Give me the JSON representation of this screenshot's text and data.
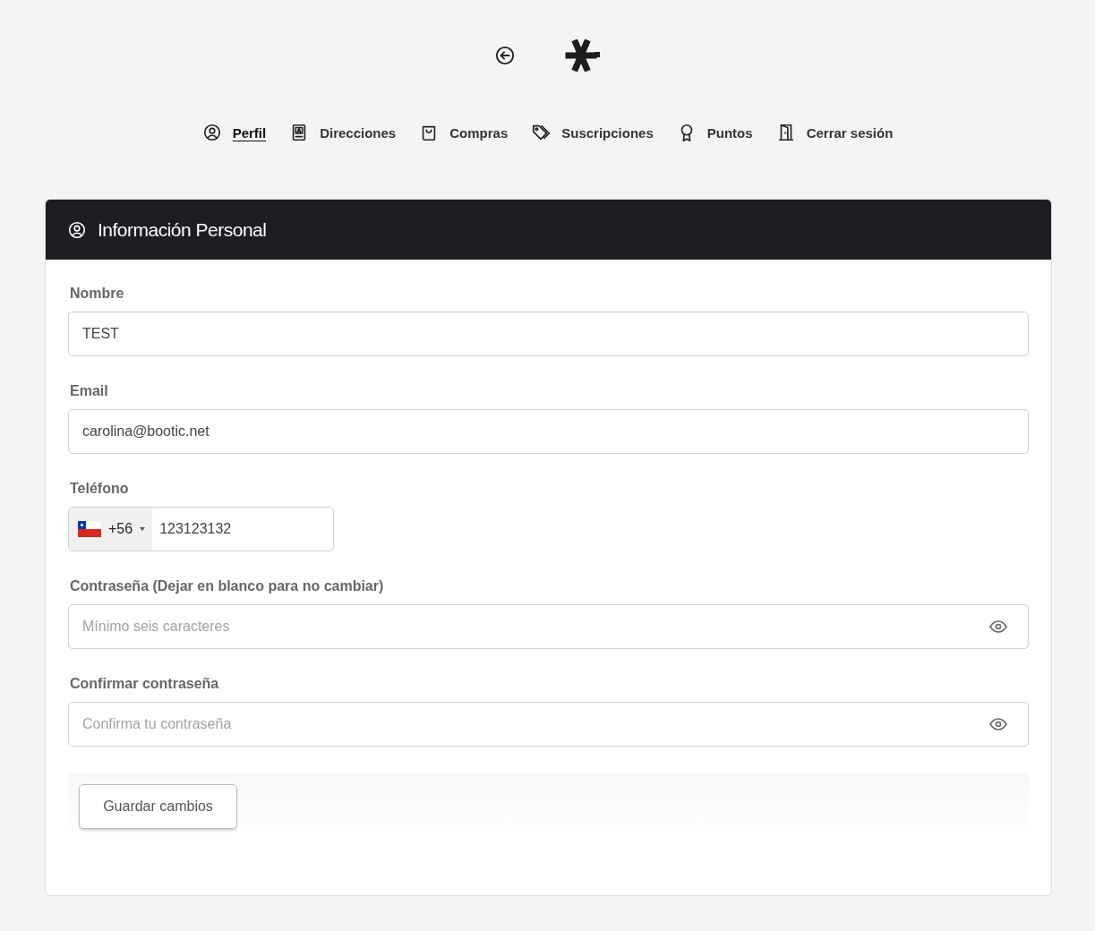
{
  "nav": [
    {
      "label": "Perfil",
      "selected": true
    },
    {
      "label": "Direcciones",
      "selected": false
    },
    {
      "label": "Compras",
      "selected": false
    },
    {
      "label": "Suscripciones",
      "selected": false
    },
    {
      "label": "Puntos",
      "selected": false
    },
    {
      "label": "Cerrar sesión",
      "selected": false
    }
  ],
  "card": {
    "title": "Información Personal",
    "fields": [
      {
        "kind": "text",
        "label": "Nombre",
        "value": "TEST"
      },
      {
        "kind": "text",
        "label": "Email",
        "value": "carolina@bootic.net"
      },
      {
        "kind": "phone",
        "label": "Teléfono",
        "code": "+56",
        "value": "123123132"
      },
      {
        "kind": "password",
        "label": "Contraseña (Dejar en blanco para no cambiar)",
        "placeholder": "Mínimo seis caracteres"
      },
      {
        "kind": "password",
        "label": "Confirmar contraseña",
        "placeholder": "Confirma tu contraseña"
      }
    ],
    "button": "Guardar cambios"
  }
}
